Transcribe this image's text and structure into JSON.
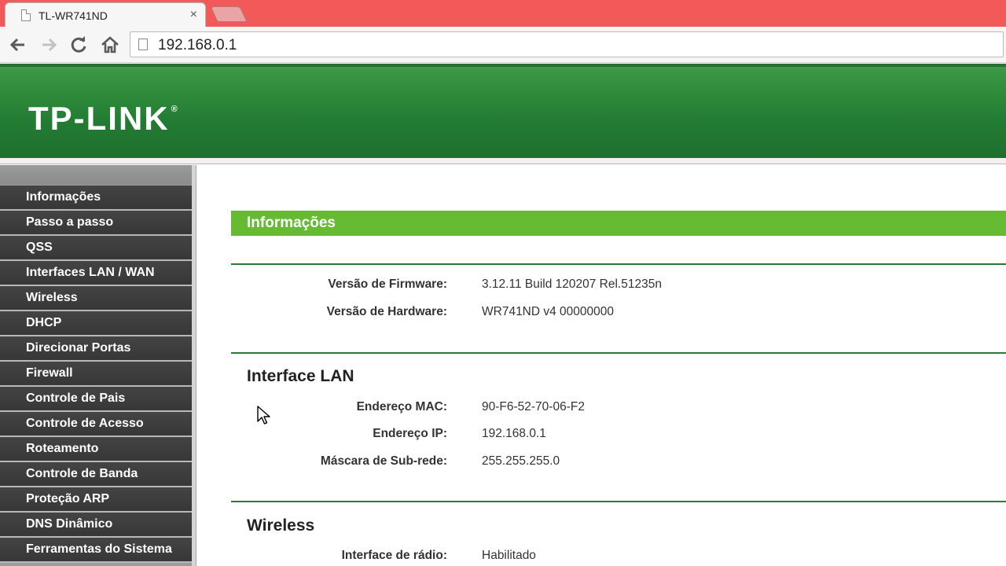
{
  "browser": {
    "tab_title": "TL-WR741ND",
    "tab_close": "×",
    "url": "192.168.0.1"
  },
  "router": {
    "logo": "TP-LINK",
    "logo_mark": "®",
    "menu": [
      "Informações",
      "Passo a passo",
      "QSS",
      "Interfaces LAN / WAN",
      "Wireless",
      "DHCP",
      "Direcionar Portas",
      "Firewall",
      "Controle de Pais",
      "Controle de Acesso",
      "Roteamento",
      "Controle de Banda",
      "Proteção ARP",
      "DNS Dinâmico",
      "Ferramentas do Sistema"
    ],
    "section_title": "Informações",
    "firmware_label": "Versão de Firmware:",
    "firmware_value": "3.12.11 Build 120207 Rel.51235n",
    "hardware_label": "Versão de Hardware:",
    "hardware_value": "WR741ND v4 00000000",
    "lan": {
      "heading": "Interface LAN",
      "mac_label": "Endereço MAC:",
      "mac_value": "90-F6-52-70-06-F2",
      "ip_label": "Endereço IP:",
      "ip_value": "192.168.0.1",
      "mask_label": "Máscara de Sub-rede:",
      "mask_value": "255.255.255.0"
    },
    "wireless": {
      "heading": "Wireless",
      "radio_label": "Interface de rádio:",
      "radio_value": "Habilitado"
    }
  },
  "colors": {
    "tabstrip": "#f25a5a",
    "banner_green": "#2e8a3a",
    "section_green": "#66bb33",
    "menu_dark": "#3d3d3d"
  }
}
